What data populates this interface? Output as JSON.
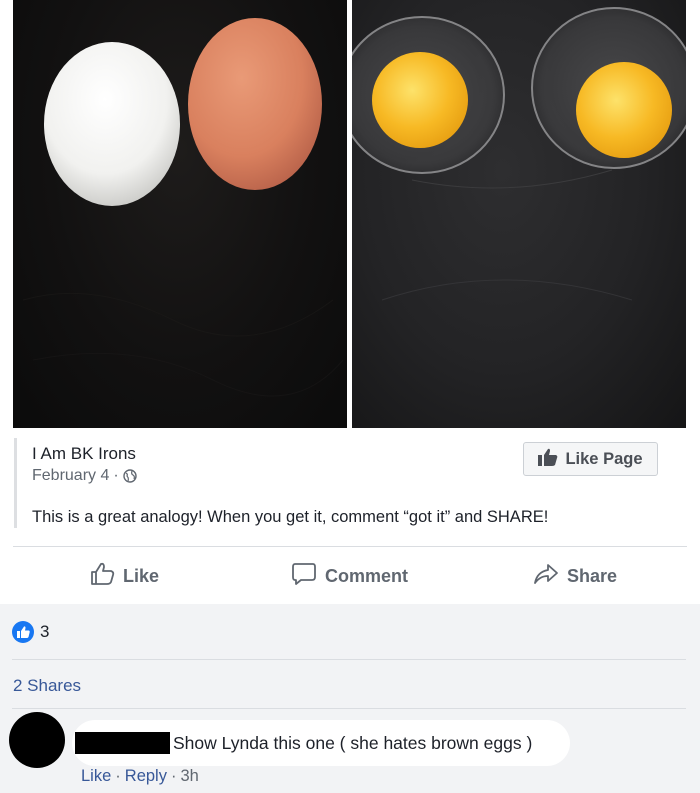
{
  "post": {
    "page_name": "I Am BK Irons",
    "date": "February 4",
    "date_separator": "·",
    "text": "This is a great analogy! When you get it, comment “got it” and SHARE!",
    "like_page_label": "Like Page"
  },
  "actions": {
    "like_label": "Like",
    "comment_label": "Comment",
    "share_label": "Share"
  },
  "feedback": {
    "reaction_count": "3",
    "shares_label": "2 Shares"
  },
  "comment": {
    "text": "Show Lynda this one ( she hates brown eggs )",
    "like_label": "Like",
    "separator": "·",
    "reply_label": "Reply",
    "time": "3h"
  },
  "icons": {
    "globe": "globe-icon",
    "thumbs_up": "thumbs-up-icon",
    "comment": "comment-bubble-icon",
    "share": "share-arrow-icon"
  },
  "colors": {
    "brand_blue": "#1877f2",
    "link_blue": "#385898",
    "feedback_bg": "#f2f3f5",
    "egg_white": "#f4f4f2",
    "egg_brown": "#d9815f",
    "yolk": "#f6b321"
  }
}
